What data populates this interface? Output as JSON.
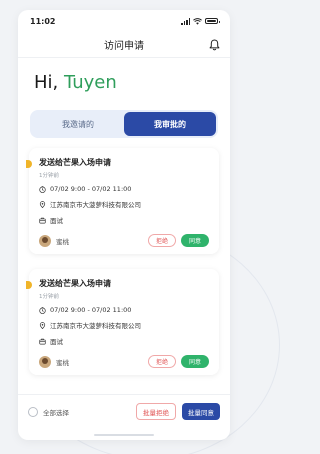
{
  "status_bar": {
    "time": "11:02"
  },
  "nav": {
    "title": "访问申请"
  },
  "greeting": {
    "prefix": "Hi, ",
    "name": "Tuyen"
  },
  "tabs": [
    {
      "label": "我邀请的",
      "active": false
    },
    {
      "label": "我审批的",
      "active": true
    }
  ],
  "cards": [
    {
      "title": "发送给芒果入场申请",
      "subtitle": "1分钟前",
      "time_range": "07/02 9:00 - 07/02 11:00",
      "location": "江苏南京市大菠萝科技有限公司",
      "purpose": "面试",
      "person": "蜜桃",
      "reject_label": "拒绝",
      "agree_label": "同意"
    },
    {
      "title": "发送给芒果入场申请",
      "subtitle": "1分钟前",
      "time_range": "07/02 9:00 - 07/02 11:00",
      "location": "江苏南京市大菠萝科技有限公司",
      "purpose": "面试",
      "person": "蜜桃",
      "reject_label": "拒绝",
      "agree_label": "同意"
    }
  ],
  "bottom_bar": {
    "select_all": "全部选择",
    "batch_reject": "批量拒绝",
    "batch_agree": "批量同意"
  },
  "colors": {
    "accent_blue": "#2b4aa6",
    "name_green": "#2f9e5b",
    "agree_green": "#2fb36b",
    "reject_red": "#e05353",
    "dot_yellow": "#f0b429"
  },
  "icons": [
    "signal-icon",
    "wifi-icon",
    "battery-icon",
    "bell-icon",
    "clock-icon",
    "location-pin-icon",
    "briefcase-icon",
    "avatar"
  ]
}
